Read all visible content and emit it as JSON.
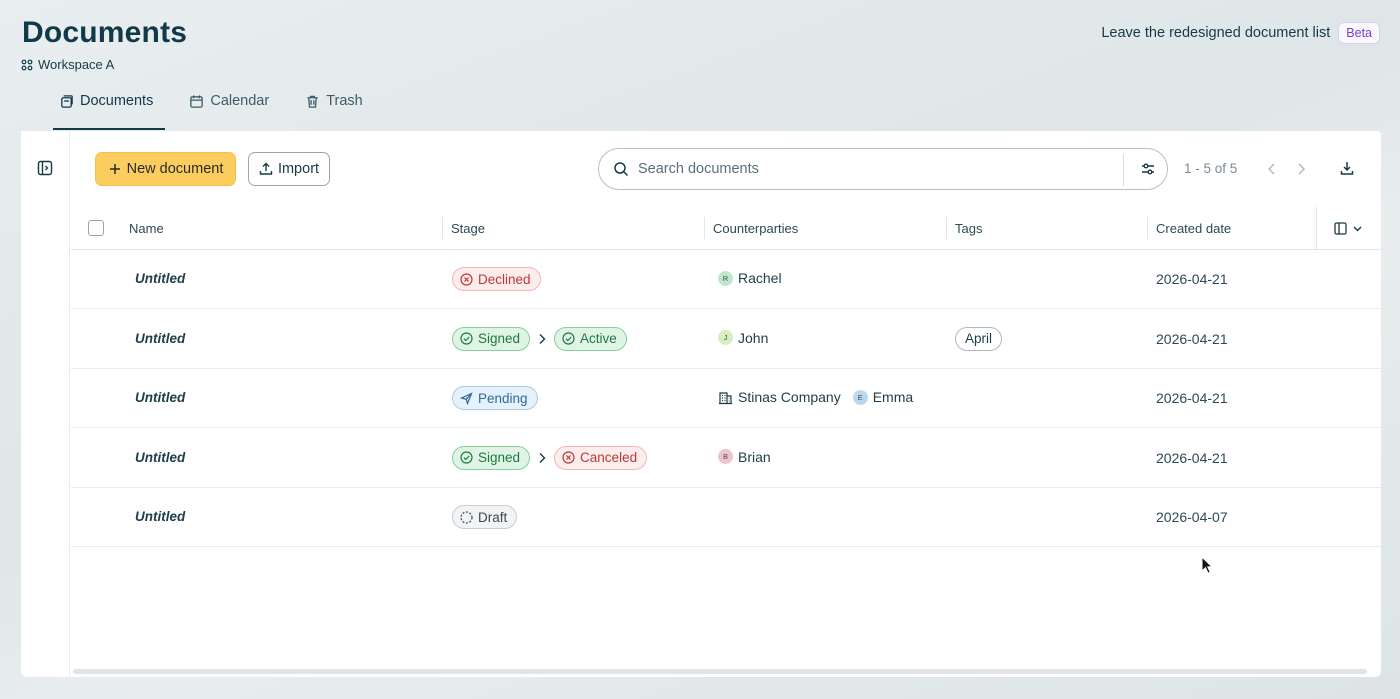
{
  "header": {
    "title": "Documents",
    "workspace": "Workspace A",
    "leave_link": "Leave the redesigned document list",
    "beta_badge": "Beta"
  },
  "tabs": [
    {
      "label": "Documents",
      "icon": "documents-icon",
      "active": true
    },
    {
      "label": "Calendar",
      "icon": "calendar-icon",
      "active": false
    },
    {
      "label": "Trash",
      "icon": "trash-icon",
      "active": false
    }
  ],
  "toolbar": {
    "new_document_label": "New document",
    "import_label": "Import",
    "search_placeholder": "Search documents",
    "pagination": "1 - 5 of 5"
  },
  "table": {
    "columns": [
      "Name",
      "Stage",
      "Counterparties",
      "Tags",
      "Created date"
    ],
    "rows": [
      {
        "name": "Untitled",
        "stages": [
          {
            "label": "Declined",
            "kind": "red",
            "icon": "x-circle-icon"
          }
        ],
        "parties": [
          {
            "type": "person",
            "initial": "R",
            "name": "Rachel",
            "color": "#bfe8cb"
          }
        ],
        "tags": [],
        "date": "2026-04-21"
      },
      {
        "name": "Untitled",
        "stages": [
          {
            "label": "Signed",
            "kind": "green",
            "icon": "check-circle-icon"
          },
          {
            "label": "Active",
            "kind": "green",
            "icon": "check-circle-icon"
          }
        ],
        "parties": [
          {
            "type": "person",
            "initial": "J",
            "name": "John",
            "color": "#d7efbf"
          }
        ],
        "tags": [
          "April"
        ],
        "date": "2026-04-21"
      },
      {
        "name": "Untitled",
        "stages": [
          {
            "label": "Pending",
            "kind": "blue",
            "icon": "send-icon"
          }
        ],
        "parties": [
          {
            "type": "company",
            "name": "Stinas Company"
          },
          {
            "type": "person",
            "initial": "E",
            "name": "Emma",
            "color": "#bcd8ee"
          }
        ],
        "tags": [],
        "date": "2026-04-21"
      },
      {
        "name": "Untitled",
        "stages": [
          {
            "label": "Signed",
            "kind": "green",
            "icon": "check-circle-icon"
          },
          {
            "label": "Canceled",
            "kind": "red",
            "icon": "x-circle-icon"
          }
        ],
        "parties": [
          {
            "type": "person",
            "initial": "B",
            "name": "Brian",
            "color": "#efc4cc"
          }
        ],
        "tags": [],
        "date": "2026-04-21"
      },
      {
        "name": "Untitled",
        "stages": [
          {
            "label": "Draft",
            "kind": "gray",
            "icon": "dashed-circle-icon"
          }
        ],
        "parties": [],
        "tags": [],
        "date": "2026-04-07"
      }
    ]
  },
  "colors": {
    "accent": "#fbcd5e",
    "text": "#12394a",
    "beta": "#7a3bd0"
  }
}
